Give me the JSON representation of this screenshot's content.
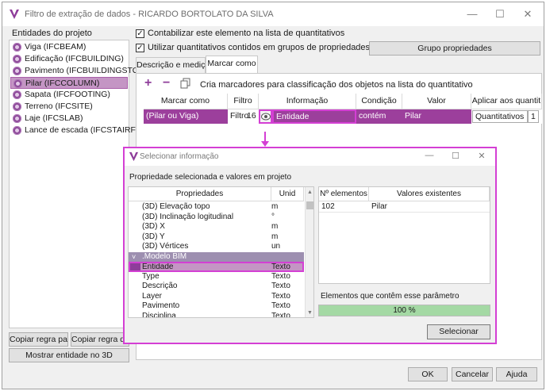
{
  "window": {
    "title": "Filtro de extração de dados - RICARDO BORTOLATO DA SILVA",
    "minimize": "—",
    "maximize": "☐",
    "close": "✕"
  },
  "entities": {
    "label": "Entidades do projeto",
    "items": [
      {
        "label": "Viga (IFCBEAM)"
      },
      {
        "label": "Edificação (IFCBUILDING)"
      },
      {
        "label": "Pavimento (IFCBUILDINGSTOREY)"
      },
      {
        "label": "Pilar (IFCCOLUMN)",
        "selected": true
      },
      {
        "label": "Sapata (IFCFOOTING)"
      },
      {
        "label": "Terreno (IFCSITE)"
      },
      {
        "label": "Laje (IFCSLAB)"
      },
      {
        "label": "Lance de escada (IFCSTAIRFLIGHT)"
      }
    ],
    "copy_rule_1": "Copiar regra para...",
    "copy_rule_2": "Copiar regra de...",
    "show_3d": "Mostrar entidade no 3D"
  },
  "options": {
    "count_label": "Contabilizar este elemento na lista de quantitativos",
    "groups_label": "Utilizar quantitativos contidos em grupos de propriedades",
    "group_button": "Grupo propriedades",
    "check_mark": "✓"
  },
  "tabs": [
    {
      "label": "Descrição e medição"
    },
    {
      "label": "Marcar como",
      "active": true
    }
  ],
  "marker": {
    "add": "+",
    "remove": "−",
    "description": "Cria marcadores para classificação dos objetos na lista do quantitativo",
    "headers": [
      "Marcar como",
      "Filtro",
      "Informação",
      "Condição",
      "Valor",
      "Aplicar aos quantit"
    ],
    "row": {
      "mark": "(Pilar ou Viga)",
      "filter": "Filtro",
      "filter_num": "16",
      "info": "Entidade",
      "condition": "contém",
      "value": "Pilar",
      "apply": "Quantitativos",
      "apply_num": "1"
    }
  },
  "popup": {
    "title": "Selecionar informação",
    "subtitle": "Propriedade selecionada e valores em projeto",
    "headers": {
      "prop": "Propriedades",
      "unit": "Unid",
      "count": "Nº elementos",
      "values": "Valores existentes"
    },
    "properties": [
      {
        "name": "(3D) Elevação topo",
        "unit": "m"
      },
      {
        "name": "(3D) Inclinação logitudinal",
        "unit": "°"
      },
      {
        "name": "(3D) X",
        "unit": "m"
      },
      {
        "name": "(3D) Y",
        "unit": "m"
      },
      {
        "name": "(3D) Vértices",
        "unit": "un"
      },
      {
        "name": ".Modelo BIM",
        "unit": "",
        "group": true
      },
      {
        "name": "Entidade",
        "unit": "Texto",
        "selected": true
      },
      {
        "name": "Type",
        "unit": "Texto"
      },
      {
        "name": "Descrição",
        "unit": "Texto"
      },
      {
        "name": "Layer",
        "unit": "Texto"
      },
      {
        "name": "Pavimento",
        "unit": "Texto"
      },
      {
        "name": "Disciplina",
        "unit": "Texto"
      }
    ],
    "values_rows": [
      {
        "count": "102",
        "value": "Pilar"
      }
    ],
    "elements_label": "Elementos que contêm esse parâmetro",
    "progress": 1.0,
    "progress_text": "100 %",
    "select_button": "Selecionar"
  },
  "footer": {
    "ok": "OK",
    "cancel": "Cancelar",
    "help": "Ajuda"
  },
  "colors": {
    "brand": "#8e3d9a",
    "selection": "#c495c4",
    "row_highlight": "#9c3f9c",
    "annotation": "#d43fd4",
    "progress": "#a4d9a4"
  }
}
